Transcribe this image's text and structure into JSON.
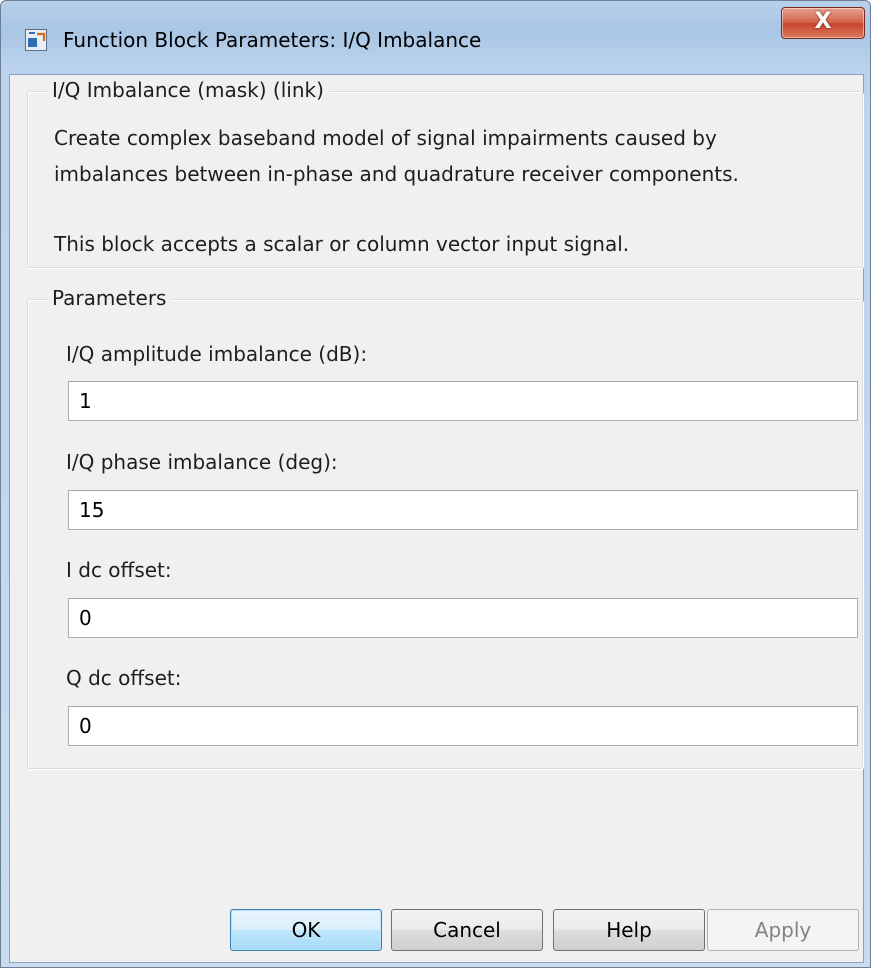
{
  "window": {
    "title": "Function Block Parameters: I/Q Imbalance",
    "close_label": "X"
  },
  "mask_group": {
    "legend": "I/Q Imbalance (mask) (link)",
    "description_line1": "Create complex baseband model of signal impairments caused by",
    "description_line2": "imbalances between in-phase and quadrature receiver components.",
    "description_line3": "This block accepts a scalar or column vector input signal."
  },
  "params_group": {
    "legend": "Parameters",
    "fields": [
      {
        "label": "I/Q amplitude imbalance (dB):",
        "value": "1"
      },
      {
        "label": "I/Q phase imbalance (deg):",
        "value": "15"
      },
      {
        "label": "I dc offset:",
        "value": "0"
      },
      {
        "label": "Q dc offset:",
        "value": "0"
      }
    ]
  },
  "buttons": {
    "ok": "OK",
    "cancel": "Cancel",
    "help": "Help",
    "apply": "Apply"
  },
  "icons": {
    "title_icon": "simulink-block-icon",
    "close_icon": "close-icon"
  },
  "colors": {
    "title_bar": "#b8d0ea",
    "client_background": "#f0f0f0",
    "close_button": "#c8442a",
    "default_button_border": "#3c7fb1"
  }
}
